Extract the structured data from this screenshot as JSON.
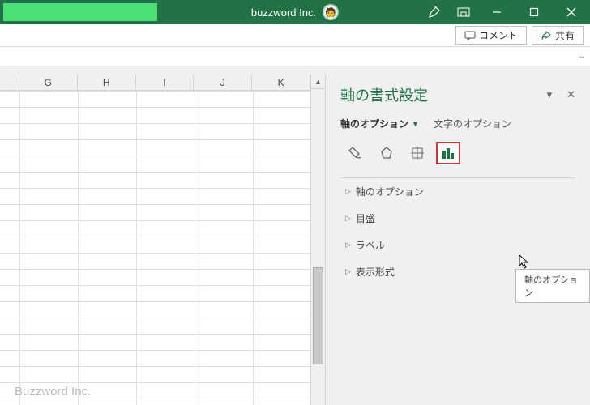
{
  "titlebar": {
    "title": "buzzword Inc.",
    "avatar_glyph": "🧑"
  },
  "ribbon": {
    "comment_label": "コメント",
    "share_label": "共有"
  },
  "columns": [
    "G",
    "H",
    "I",
    "J",
    "K"
  ],
  "watermark": "Buzzword Inc.",
  "pane": {
    "title": "軸の書式設定",
    "tab_axis": "軸のオプション",
    "tab_text": "文字のオプション",
    "tooltip": "軸のオプション",
    "sections": [
      "軸のオプション",
      "目盛",
      "ラベル",
      "表示形式"
    ]
  }
}
